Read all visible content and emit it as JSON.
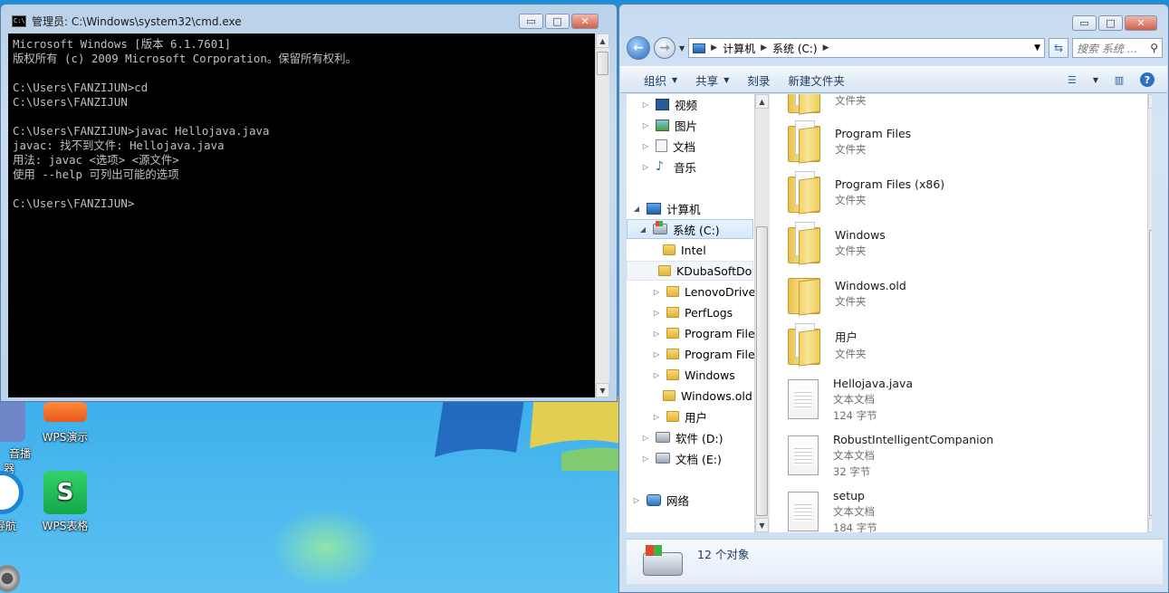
{
  "cmd": {
    "title": "管理员: C:\\Windows\\system32\\cmd.exe",
    "icon_text": "C:\\",
    "minimize": "▭",
    "maximize": "□",
    "close": "✕",
    "lines": [
      "Microsoft Windows [版本 6.1.7601]",
      "版权所有 (c) 2009 Microsoft Corporation。保留所有权利。",
      "",
      "C:\\Users\\FANZIJUN>cd",
      "C:\\Users\\FANZIJUN",
      "",
      "C:\\Users\\FANZIJUN>javac Hellojava.java",
      "javac: 找不到文件: Hellojava.java",
      "用法: javac <选项> <源文件>",
      "使用 --help 可列出可能的选项",
      "",
      "C:\\Users\\FANZIJUN>"
    ]
  },
  "desktop": {
    "icons": [
      {
        "label": "音播",
        "label2": "器"
      },
      {
        "label": "WPS演示"
      },
      {
        "label": "导航"
      },
      {
        "label": "WPS表格"
      }
    ]
  },
  "explorer": {
    "breadcrumb": [
      "计算机",
      "系统 (C:)"
    ],
    "search_placeholder": "搜索 系统 ...",
    "toolbar": {
      "organize": "组织",
      "share": "共享",
      "burn": "刻录",
      "new_folder": "新建文件夹"
    },
    "nav": [
      {
        "label": "视频"
      },
      {
        "label": "图片"
      },
      {
        "label": "文档"
      },
      {
        "label": "音乐"
      },
      {
        "label": "计算机"
      },
      {
        "label": "系统 (C:)"
      },
      {
        "label": "Intel"
      },
      {
        "label": "KDubaSoftDo"
      },
      {
        "label": "LenovoDrivers"
      },
      {
        "label": "PerfLogs"
      },
      {
        "label": "Program Files"
      },
      {
        "label": "Program Files"
      },
      {
        "label": "Windows"
      },
      {
        "label": "Windows.old"
      },
      {
        "label": "用户"
      },
      {
        "label": "软件 (D:)"
      },
      {
        "label": "文档 (E:)"
      },
      {
        "label": "网络"
      }
    ],
    "files": [
      {
        "name": "",
        "type": "文件夹",
        "kind": "folder"
      },
      {
        "name": "Program Files",
        "type": "文件夹",
        "kind": "folder"
      },
      {
        "name": "Program Files (x86)",
        "type": "文件夹",
        "kind": "folder"
      },
      {
        "name": "Windows",
        "type": "文件夹",
        "kind": "folder"
      },
      {
        "name": "Windows.old",
        "type": "文件夹",
        "kind": "folder"
      },
      {
        "name": "用户",
        "type": "文件夹",
        "kind": "folder"
      },
      {
        "name": "Hellojava.java",
        "type": "文本文档",
        "size": "124 字节",
        "kind": "doc"
      },
      {
        "name": "RobustIntelligentCompanion",
        "type": "文本文档",
        "size": "32 字节",
        "kind": "doc"
      },
      {
        "name": "setup",
        "type": "文本文档",
        "size": "184 字节",
        "kind": "doc"
      }
    ],
    "status": "12 个对象"
  }
}
